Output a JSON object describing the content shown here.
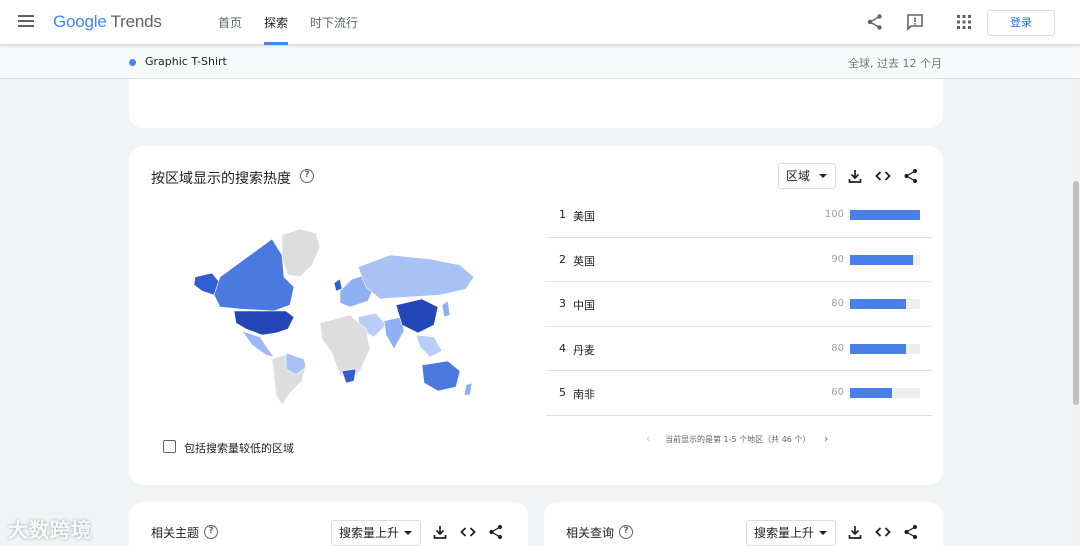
{
  "header": {
    "logo": {
      "google": "Google",
      "trends": "Trends"
    },
    "tabs": [
      {
        "label": "首页",
        "active": false
      },
      {
        "label": "探索",
        "active": true
      },
      {
        "label": "时下流行",
        "active": false
      }
    ],
    "login_label": "登录",
    "accent": "#4285f4"
  },
  "termbar": {
    "term": "Graphic T-Shirt",
    "meta": "全球, 过去 12 个月",
    "dot_color": "#4285f4"
  },
  "region_card": {
    "title": "按区域显示的搜索热度",
    "help": "?",
    "dropdown_label": "区域",
    "rows": [
      {
        "rank": "1",
        "name": "美国",
        "value": "100",
        "fraction": 1.0
      },
      {
        "rank": "2",
        "name": "英国",
        "value": "90",
        "fraction": 0.9
      },
      {
        "rank": "3",
        "name": "中国",
        "value": "80",
        "fraction": 0.8
      },
      {
        "rank": "4",
        "name": "丹麦",
        "value": "80",
        "fraction": 0.8
      },
      {
        "rank": "5",
        "name": "南非",
        "value": "60",
        "fraction": 0.6
      }
    ],
    "pager_text": "当前显示的是第 1-5 个地区（共 46 个）",
    "checkbox_label": "包括搜索量较低的区域",
    "bar_color": "#4a7fe8"
  },
  "topics_card": {
    "title": "相关主题",
    "help": "?",
    "dropdown_label": "搜索量上升"
  },
  "queries_card": {
    "title": "相关查询",
    "help": "?",
    "dropdown_label": "搜索量上升"
  },
  "watermark": "大数跨境"
}
